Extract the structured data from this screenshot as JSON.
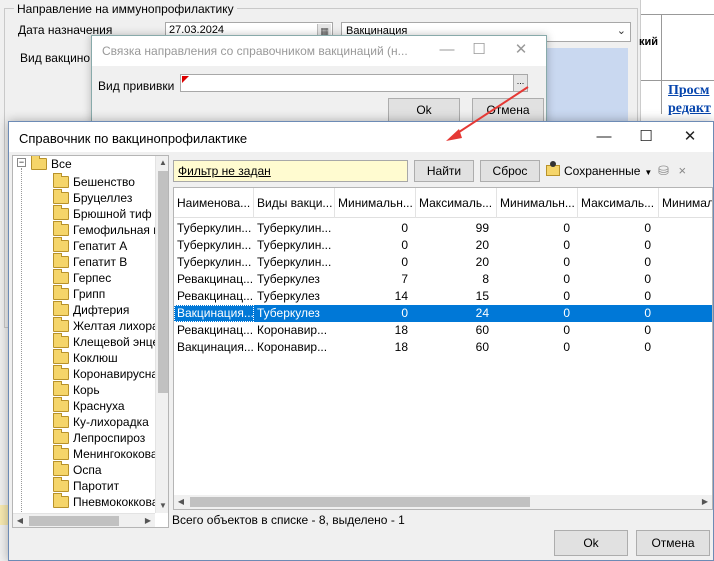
{
  "background_form": {
    "group_title": "Направление на иммунопрофилактику",
    "date_label": "Дата назначения",
    "date_value": "27.03.2024",
    "type_value": "Вакцинация",
    "vid_label": "Вид вакцино"
  },
  "web_panel": {
    "header_fragment": "кий",
    "link1": "Просм",
    "link2": "редакт"
  },
  "link_dialog": {
    "title": "Связка направления со справочником вакцинаций (н...",
    "field_label": "Вид прививки",
    "field_button": "...",
    "ok_label": "Ok",
    "cancel_label": "Отмена"
  },
  "main_dialog": {
    "title": "Справочник по вакцинопрофилактике",
    "tree": {
      "root": "Все",
      "items": [
        "Бешенство",
        "Бруцеллез",
        "Брюшной тиф",
        "Гемофильная ин",
        "Гепатит А",
        "Гепатит В",
        "Герпес",
        "Грипп",
        "Дифтерия",
        "Желтая лихорад",
        "Клещевой энце",
        "Коклюш",
        "Коронавирусная",
        "Корь",
        "Краснуха",
        "Ку-лихорадка",
        "Лепроспироз",
        "Менингококовая",
        "Оспа",
        "Паротит",
        "Пневмококковая"
      ]
    },
    "toolbar": {
      "filter_text": "Фильтр не задан",
      "find_label": "Найти",
      "reset_label": "Сброс",
      "saved_label": "Сохраненные",
      "saved_arrow": "▼",
      "clear_icon": "×"
    },
    "grid": {
      "columns": [
        "Наименова...",
        "Виды вакци...",
        "Минимальн...",
        "Максималь...",
        "Минимальн...",
        "Максималь...",
        "Минималь"
      ],
      "rows": [
        [
          "Туберкулин...",
          "Туберкулин...",
          "0",
          "99",
          "0",
          "0"
        ],
        [
          "Туберкулин...",
          "Туберкулин...",
          "0",
          "20",
          "0",
          "0"
        ],
        [
          "Туберкулин...",
          "Туберкулин...",
          "0",
          "20",
          "0",
          "0"
        ],
        [
          "Ревакцинац...",
          "Туберкулез",
          "7",
          "8",
          "0",
          "0"
        ],
        [
          "Ревакцинац...",
          "Туберкулез",
          "14",
          "15",
          "0",
          "0"
        ],
        [
          "Вакцинация...",
          "Туберкулез",
          "0",
          "24",
          "0",
          "0"
        ],
        [
          "Ревакцинац...",
          "Коронавир...",
          "18",
          "60",
          "0",
          "0"
        ],
        [
          "Вакцинация...",
          "Коронавир...",
          "18",
          "60",
          "0",
          "0"
        ]
      ],
      "selected_row": 5
    },
    "status": "Всего объектов в списке - 8, выделено - 1",
    "ok_label": "Ok",
    "cancel_label": "Отмена"
  },
  "colors": {
    "selection": "#0078d7",
    "filter_bg": "#fffbd0",
    "arrow": "#e53935",
    "link": "#0645ad"
  }
}
